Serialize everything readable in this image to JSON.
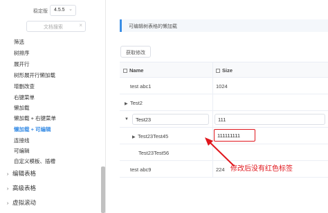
{
  "sidebar": {
    "version_label": "稳定版",
    "version_value": "4.5.5",
    "search_placeholder": "文档搜索",
    "items": [
      {
        "label": "筛选"
      },
      {
        "label": "树排序"
      },
      {
        "label": "展开行"
      },
      {
        "label": "树形展开行懒加载"
      },
      {
        "label": "增删改查"
      },
      {
        "label": "右键菜单"
      },
      {
        "label": "懒加载"
      },
      {
        "label": "懒加载 + 右键菜单"
      },
      {
        "label": "懒加载 + 可编辑"
      },
      {
        "label": "连接线"
      },
      {
        "label": "可编辑"
      },
      {
        "label": "自定义模板、插槽"
      }
    ],
    "groups": [
      {
        "label": "编辑表格"
      },
      {
        "label": "高级表格"
      },
      {
        "label": "虚拟滚动"
      }
    ]
  },
  "main": {
    "title": "可编辑树表格的懒加载",
    "button_label": "获取修改",
    "columns": [
      "Name",
      "Size"
    ],
    "rows": [
      {
        "name": "test abc1",
        "size": "1024"
      },
      {
        "name": "Test2",
        "size": ""
      },
      {
        "name": "Test23",
        "size": "111"
      },
      {
        "name": "Test23Test45",
        "size": "111111111"
      },
      {
        "name": "Test23Test56",
        "size": ""
      },
      {
        "name": "test abc9",
        "size": "224"
      }
    ],
    "annotation": "修改后没有红色标签",
    "accent_color": "#3a8ee6",
    "annotation_color": "#e0161c"
  }
}
